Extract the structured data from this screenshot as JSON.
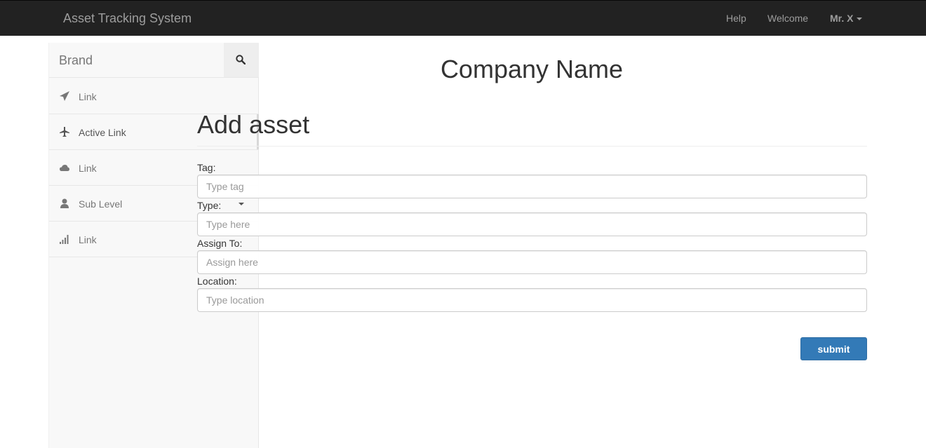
{
  "navbar": {
    "title": "Asset Tracking System",
    "help": "Help",
    "welcome": "Welcome",
    "user": "Mr. X"
  },
  "sidebar": {
    "brand": "Brand",
    "items": [
      {
        "label": "Link",
        "icon": "paper-plane-icon"
      },
      {
        "label": "Active Link",
        "icon": "plane-icon"
      },
      {
        "label": "Link",
        "icon": "cloud-icon"
      },
      {
        "label": "Sub Level",
        "icon": "user-icon"
      },
      {
        "label": "Link",
        "icon": "signal-bars-icon"
      }
    ]
  },
  "main": {
    "company": "Company Name",
    "heading": "Add asset",
    "fields": {
      "tag": {
        "label": "Tag:",
        "placeholder": "Type tag"
      },
      "type": {
        "label": "Type:",
        "placeholder": "Type here"
      },
      "assign": {
        "label": "Assign To:",
        "placeholder": "Assign here"
      },
      "location": {
        "label": "Location:",
        "placeholder": "Type location"
      }
    },
    "submit": "submit"
  },
  "colors": {
    "navbar_bg": "#222222",
    "sidebar_bg": "#f8f8f8",
    "primary": "#337ab7"
  }
}
